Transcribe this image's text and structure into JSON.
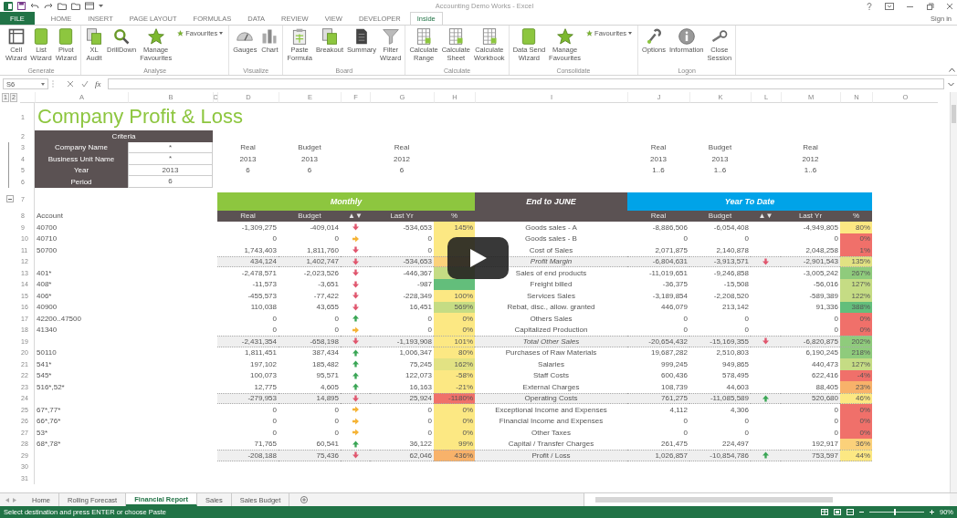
{
  "window": {
    "title": "Accounting Demo Works - Excel"
  },
  "ribbon_tabs": [
    {
      "label": "FILE",
      "kind": "file",
      "selected": false
    },
    {
      "label": "HOME",
      "kind": "tab",
      "selected": false
    },
    {
      "label": "INSERT",
      "kind": "tab",
      "selected": false
    },
    {
      "label": "PAGE LAYOUT",
      "kind": "tab",
      "selected": false
    },
    {
      "label": "FORMULAS",
      "kind": "tab",
      "selected": false
    },
    {
      "label": "DATA",
      "kind": "tab",
      "selected": false
    },
    {
      "label": "REVIEW",
      "kind": "tab",
      "selected": false
    },
    {
      "label": "VIEW",
      "kind": "tab",
      "selected": false
    },
    {
      "label": "DEVELOPER",
      "kind": "tab",
      "selected": false
    },
    {
      "label": "Inside",
      "kind": "tab",
      "selected": true
    }
  ],
  "sign_in": "Sign in",
  "ribbon_groups": [
    {
      "label": "Generate",
      "buttons": [
        {
          "label": "Cell\nWizard",
          "kind": "large"
        },
        {
          "label": "List\nWizard",
          "kind": "large"
        },
        {
          "label": "Pivot\nWizard",
          "kind": "large"
        }
      ]
    },
    {
      "label": "Analyse",
      "buttons": [
        {
          "label": "XL\nAudit",
          "kind": "large"
        },
        {
          "label": "DrillDown",
          "kind": "large"
        },
        {
          "label": "Manage\nFavourites",
          "kind": "large"
        },
        {
          "label": "Favourites",
          "kind": "dropdown"
        }
      ]
    },
    {
      "label": "Visualize",
      "buttons": [
        {
          "label": "Gauges",
          "kind": "large"
        },
        {
          "label": "Chart",
          "kind": "large"
        }
      ]
    },
    {
      "label": "Board",
      "buttons": [
        {
          "label": "Paste\nFormula",
          "kind": "large"
        },
        {
          "label": "Breakout",
          "kind": "large"
        },
        {
          "label": "Summary",
          "kind": "large"
        },
        {
          "label": "Filter\nWizard",
          "kind": "large"
        }
      ]
    },
    {
      "label": "Calculate",
      "buttons": [
        {
          "label": "Calculate\nRange",
          "kind": "large"
        },
        {
          "label": "Calculate\nSheet",
          "kind": "large"
        },
        {
          "label": "Calculate\nWorkbook",
          "kind": "large"
        }
      ]
    },
    {
      "label": "Consolidate",
      "buttons": [
        {
          "label": "Data Send\nWizard",
          "kind": "large"
        },
        {
          "label": "Manage\nFavourites",
          "kind": "large"
        },
        {
          "label": "Favourites",
          "kind": "dropdown"
        }
      ]
    },
    {
      "label": "Logon",
      "buttons": [
        {
          "label": "Options",
          "kind": "large"
        },
        {
          "label": "Information",
          "kind": "large"
        },
        {
          "label": "Close\nSession",
          "kind": "large"
        }
      ]
    }
  ],
  "formula_bar": {
    "name_box": "S6",
    "function_label": "fx"
  },
  "outline_levels": [
    "1",
    "2"
  ],
  "columns": [
    "A",
    "B",
    "C",
    "D",
    "E",
    "F",
    "G",
    "H",
    "I",
    "J",
    "K",
    "L",
    "M",
    "N",
    "O"
  ],
  "row_numbers": [
    "1",
    "2",
    "3",
    "4",
    "5",
    "6",
    "7",
    "8",
    "9",
    "10",
    "11",
    "12",
    "13",
    "14",
    "15",
    "16",
    "17",
    "18",
    "19",
    "20",
    "21",
    "22",
    "23",
    "24",
    "25",
    "26",
    "27",
    "28",
    "29",
    "30",
    "31"
  ],
  "sheet_title": "Company Profit & Loss",
  "criteria": {
    "header": "Criteria",
    "rows": [
      {
        "label": "Company Name",
        "value": "*"
      },
      {
        "label": "Business Unit Name",
        "value": "*"
      },
      {
        "label": "Year",
        "value": "2013"
      },
      {
        "label": "Period",
        "value": "6"
      }
    ]
  },
  "period_headers": [
    {
      "label": "Real",
      "year": "2013",
      "period": "6"
    },
    {
      "label": "Budget",
      "year": "2013",
      "period": "6"
    },
    {
      "label": "Real",
      "year": "2012",
      "period": "6"
    },
    {
      "label": "Real",
      "year": "2013",
      "period": "1..6"
    },
    {
      "label": "Budget",
      "year": "2013",
      "period": "1..6"
    },
    {
      "label": "Real",
      "year": "2012",
      "period": "1..6"
    }
  ],
  "bands": [
    {
      "label": "Monthly",
      "color": "#8dc63f"
    },
    {
      "label": "End to JUNE",
      "color": "#5b5253"
    },
    {
      "label": "Year To Date",
      "color": "#00a3e8"
    }
  ],
  "account_header": "Account",
  "monthly_columns": [
    "Real",
    "Budget",
    "▲▼",
    "Last Yr",
    "%"
  ],
  "ytd_columns": [
    "Real",
    "Budget",
    "▲▼",
    "Last Yr",
    "%"
  ],
  "rows": [
    {
      "account": "40700",
      "monthly": {
        "real": "-1,309,275",
        "budget": "-409,014",
        "arrow": {
          "kind": "down"
        },
        "last_yr": "-534,653",
        "pct": {
          "value": "145%",
          "color": "#fce883"
        }
      },
      "line": "Goods sales - A",
      "ytd": {
        "real": "-8,886,506",
        "budget": "-6,054,408",
        "last_yr": "-4,949,805",
        "pct": {
          "value": "80%",
          "color": "#fce883"
        }
      },
      "subtotal": false,
      "italic": false
    },
    {
      "account": "40710",
      "monthly": {
        "real": "0",
        "budget": "0",
        "arrow": {
          "kind": "right"
        },
        "last_yr": "0",
        "pct": {
          "color": "#fce883"
        }
      },
      "line": "Goods sales - B",
      "ytd": {
        "real": "0",
        "budget": "0",
        "last_yr": "0",
        "pct": {
          "value": "0%",
          "color": "#f0706a"
        }
      },
      "subtotal": false,
      "italic": false
    },
    {
      "account": "50700",
      "monthly": {
        "real": "1,743,403",
        "budget": "1,811,760",
        "arrow": {
          "kind": "down"
        },
        "last_yr": "0",
        "pct": {
          "color": "#fce883"
        }
      },
      "line": "Cost of Sales",
      "ytd": {
        "real": "2,071,875",
        "budget": "2,140,878",
        "last_yr": "2,048,258",
        "pct": {
          "value": "1%",
          "color": "#f0706a"
        }
      },
      "subtotal": false,
      "italic": false
    },
    {
      "monthly": {
        "real": "434,124",
        "budget": "1,402,747",
        "arrow": {
          "kind": "down"
        },
        "last_yr": "-534,653",
        "pct": {
          "color": "#fbd17a"
        }
      },
      "line": "Profit Margin",
      "ytd": {
        "real": "-6,804,631",
        "budget": "-3,913,571",
        "arrow": {
          "kind": "down"
        },
        "last_yr": "-2,901,543",
        "pct": {
          "value": "135%",
          "color": "#e2e283"
        }
      },
      "subtotal": true,
      "italic": true
    },
    {
      "account": "401*",
      "monthly": {
        "real": "-2,478,571",
        "budget": "-2,023,526",
        "arrow": {
          "kind": "down"
        },
        "last_yr": "-446,367",
        "pct": {
          "color": "#c5dc84"
        }
      },
      "line": "Sales of end products",
      "ytd": {
        "real": "-11,019,651",
        "budget": "-9,246,858",
        "last_yr": "-3,005,242",
        "pct": {
          "value": "267%",
          "color": "#8fcb7c"
        }
      },
      "subtotal": false,
      "italic": false
    },
    {
      "account": "408*",
      "monthly": {
        "real": "-11,573",
        "budget": "-3,651",
        "arrow": {
          "kind": "down"
        },
        "last_yr": "-987",
        "pct": {
          "color": "#63be7b"
        }
      },
      "line": "Freight billed",
      "ytd": {
        "real": "-36,375",
        "budget": "-15,508",
        "last_yr": "-56,016",
        "pct": {
          "value": "127%",
          "color": "#c5dc84"
        }
      },
      "subtotal": false,
      "italic": false
    },
    {
      "account": "406*",
      "monthly": {
        "real": "-455,573",
        "budget": "-77,422",
        "arrow": {
          "kind": "down"
        },
        "last_yr": "-228,349",
        "pct": {
          "value": "100%",
          "color": "#fce883"
        }
      },
      "line": "Services Sales",
      "ytd": {
        "real": "-3,189,854",
        "budget": "-2,208,520",
        "last_yr": "-589,389",
        "pct": {
          "value": "122%",
          "color": "#c5dc84"
        }
      },
      "subtotal": false,
      "italic": false
    },
    {
      "account": "40900",
      "monthly": {
        "real": "110,038",
        "budget": "43,655",
        "arrow": {
          "kind": "down"
        },
        "last_yr": "16,451",
        "pct": {
          "value": "569%",
          "color": "#c5dc84"
        }
      },
      "line": "Rebat, disc., allow. granted",
      "ytd": {
        "real": "446,079",
        "budget": "213,142",
        "last_yr": "91,336",
        "pct": {
          "value": "388%",
          "color": "#63be7b"
        }
      },
      "subtotal": false,
      "italic": false
    },
    {
      "account": "42200..47500",
      "monthly": {
        "real": "0",
        "budget": "0",
        "arrow": {
          "kind": "up"
        },
        "last_yr": "0",
        "pct": {
          "value": "0%",
          "color": "#fce883"
        }
      },
      "line": "Others Sales",
      "ytd": {
        "real": "0",
        "budget": "0",
        "last_yr": "0",
        "pct": {
          "value": "0%",
          "color": "#f0706a"
        }
      },
      "subtotal": false,
      "italic": false
    },
    {
      "account": "41340",
      "monthly": {
        "real": "0",
        "budget": "0",
        "arrow": {
          "kind": "right"
        },
        "last_yr": "0",
        "pct": {
          "value": "0%",
          "color": "#fce883"
        }
      },
      "line": "Capitalized Production",
      "ytd": {
        "real": "0",
        "budget": "0",
        "last_yr": "0",
        "pct": {
          "value": "0%",
          "color": "#f0706a"
        }
      },
      "subtotal": false,
      "italic": false
    },
    {
      "monthly": {
        "real": "-2,431,354",
        "budget": "-658,198",
        "arrow": {
          "kind": "down"
        },
        "last_yr": "-1,193,908",
        "pct": {
          "value": "101%",
          "color": "#fce883"
        }
      },
      "line": "Total Other Sales",
      "ytd": {
        "real": "-20,654,432",
        "budget": "-15,169,355",
        "arrow": {
          "kind": "down"
        },
        "last_yr": "-6,820,875",
        "pct": {
          "value": "202%",
          "color": "#8fcb7c"
        }
      },
      "subtotal": true,
      "italic": true
    },
    {
      "account": "50110",
      "monthly": {
        "real": "1,811,451",
        "budget": "387,434",
        "arrow": {
          "kind": "up"
        },
        "last_yr": "1,006,347",
        "pct": {
          "value": "80%",
          "color": "#fce883"
        }
      },
      "line": "Purchases of Raw Materials",
      "ytd": {
        "real": "19,687,282",
        "budget": "2,510,803",
        "last_yr": "6,190,245",
        "pct": {
          "value": "218%",
          "color": "#8fcb7c"
        }
      },
      "subtotal": false,
      "italic": false
    },
    {
      "account": "541*",
      "monthly": {
        "real": "197,102",
        "budget": "185,482",
        "arrow": {
          "kind": "up"
        },
        "last_yr": "75,245",
        "pct": {
          "value": "162%",
          "color": "#e2e283"
        }
      },
      "line": "Salaries",
      "ytd": {
        "real": "999,245",
        "budget": "949,865",
        "last_yr": "440,473",
        "pct": {
          "value": "127%",
          "color": "#c5dc84"
        }
      },
      "subtotal": false,
      "italic": false
    },
    {
      "account": "545*",
      "monthly": {
        "real": "100,073",
        "budget": "95,571",
        "arrow": {
          "kind": "up"
        },
        "last_yr": "122,073",
        "pct": {
          "value": "-58%",
          "color": "#fce883"
        }
      },
      "line": "Staff Costs",
      "ytd": {
        "real": "600,436",
        "budget": "578,495",
        "last_yr": "622,416",
        "pct": {
          "value": "-4%",
          "color": "#f0706a"
        }
      },
      "subtotal": false,
      "italic": false
    },
    {
      "account": "516*,52*",
      "monthly": {
        "real": "12,775",
        "budget": "4,605",
        "arrow": {
          "kind": "up"
        },
        "last_yr": "16,163",
        "pct": {
          "value": "-21%",
          "color": "#fce883"
        }
      },
      "line": "External Charges",
      "ytd": {
        "real": "108,739",
        "budget": "44,603",
        "last_yr": "88,405",
        "pct": {
          "value": "23%",
          "color": "#f8b26a"
        }
      },
      "subtotal": false,
      "italic": false
    },
    {
      "monthly": {
        "real": "-279,953",
        "budget": "14,895",
        "arrow": {
          "kind": "down"
        },
        "last_yr": "25,924",
        "pct": {
          "value": "-1180%",
          "color": "#f0706a"
        }
      },
      "line": "Operating Costs",
      "ytd": {
        "real": "761,275",
        "budget": "-11,085,589",
        "arrow": {
          "kind": "up"
        },
        "last_yr": "520,680",
        "pct": {
          "value": "46%",
          "color": "#fce883"
        }
      },
      "subtotal": true,
      "italic": false
    },
    {
      "account": "67*,77*",
      "monthly": {
        "real": "0",
        "budget": "0",
        "arrow": {
          "kind": "right"
        },
        "last_yr": "0",
        "pct": {
          "value": "0%",
          "color": "#fce883"
        }
      },
      "line": "Exceptional Income and Expenses",
      "ytd": {
        "real": "4,112",
        "budget": "4,306",
        "last_yr": "0",
        "pct": {
          "value": "0%",
          "color": "#f0706a"
        }
      },
      "subtotal": false,
      "italic": false
    },
    {
      "account": "66*,76*",
      "monthly": {
        "real": "0",
        "budget": "0",
        "arrow": {
          "kind": "right"
        },
        "last_yr": "0",
        "pct": {
          "value": "0%",
          "color": "#fce883"
        }
      },
      "line": "Financial Income and Expenses",
      "ytd": {
        "real": "0",
        "budget": "0",
        "last_yr": "0",
        "pct": {
          "value": "0%",
          "color": "#f0706a"
        }
      },
      "subtotal": false,
      "italic": false
    },
    {
      "account": "53*",
      "monthly": {
        "real": "0",
        "budget": "0",
        "arrow": {
          "kind": "right"
        },
        "last_yr": "0",
        "pct": {
          "value": "0%",
          "color": "#fce883"
        }
      },
      "line": "Other Taxes",
      "ytd": {
        "real": "0",
        "budget": "0",
        "last_yr": "0",
        "pct": {
          "value": "0%",
          "color": "#f0706a"
        }
      },
      "subtotal": false,
      "italic": false
    },
    {
      "account": "68*,78*",
      "monthly": {
        "real": "71,765",
        "budget": "60,541",
        "arrow": {
          "kind": "up"
        },
        "last_yr": "36,122",
        "pct": {
          "value": "99%",
          "color": "#fce883"
        }
      },
      "line": "Capital / Transfer Charges",
      "ytd": {
        "real": "261,475",
        "budget": "224,497",
        "last_yr": "192,917",
        "pct": {
          "value": "36%",
          "color": "#fbd17a"
        }
      },
      "subtotal": false,
      "italic": false
    },
    {
      "monthly": {
        "real": "-208,188",
        "budget": "75,436",
        "arrow": {
          "kind": "down"
        },
        "last_yr": "62,046",
        "pct": {
          "value": "436%",
          "color": "#f8b26a"
        }
      },
      "line": "Profit / Loss",
      "ytd": {
        "real": "1,026,857",
        "budget": "-10,854,786",
        "arrow": {
          "kind": "up"
        },
        "last_yr": "753,597",
        "pct": {
          "value": "44%",
          "color": "#fce883"
        }
      },
      "subtotal": true,
      "italic": false
    }
  ],
  "sheet_tabs": [
    {
      "label": "Home",
      "selected": false
    },
    {
      "label": "Rolling Forecast",
      "selected": false
    },
    {
      "label": "Financial Report",
      "selected": true
    },
    {
      "label": "Sales",
      "selected": false
    },
    {
      "label": "Sales Budget",
      "selected": false
    }
  ],
  "status_bar": {
    "message": "Select destination and press ENTER or choose Paste",
    "zoom": {
      "level": 0.45,
      "reading": "90%"
    }
  }
}
